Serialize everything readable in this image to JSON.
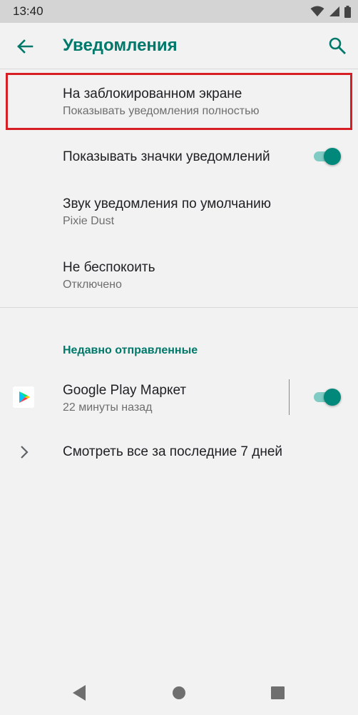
{
  "status_bar": {
    "time": "13:40"
  },
  "app_bar": {
    "title": "Уведомления",
    "back_icon": "arrow-back-icon",
    "search_icon": "search-icon"
  },
  "settings": {
    "lock_screen": {
      "title": "На заблокированном экране",
      "summary": "Показывать уведомления полностью"
    },
    "show_badges": {
      "title": "Показывать значки уведомлений",
      "enabled": true
    },
    "default_sound": {
      "title": "Звук уведомления по умолчанию",
      "summary": "Pixie Dust"
    },
    "do_not_disturb": {
      "title": "Не беспокоить",
      "summary": "Отключено"
    }
  },
  "recent": {
    "header": "Недавно отправленные",
    "apps": [
      {
        "name": "Google Play Маркет",
        "time": "22 минуты назад",
        "icon": "google-play-icon",
        "enabled": true
      }
    ],
    "see_all": "Смотреть все за последние 7 дней"
  },
  "colors": {
    "accent": "#00796b",
    "toggle_thumb": "#00897b",
    "toggle_track": "#80cbc4",
    "highlight": "#d61e24",
    "background": "#f2f2f2"
  }
}
